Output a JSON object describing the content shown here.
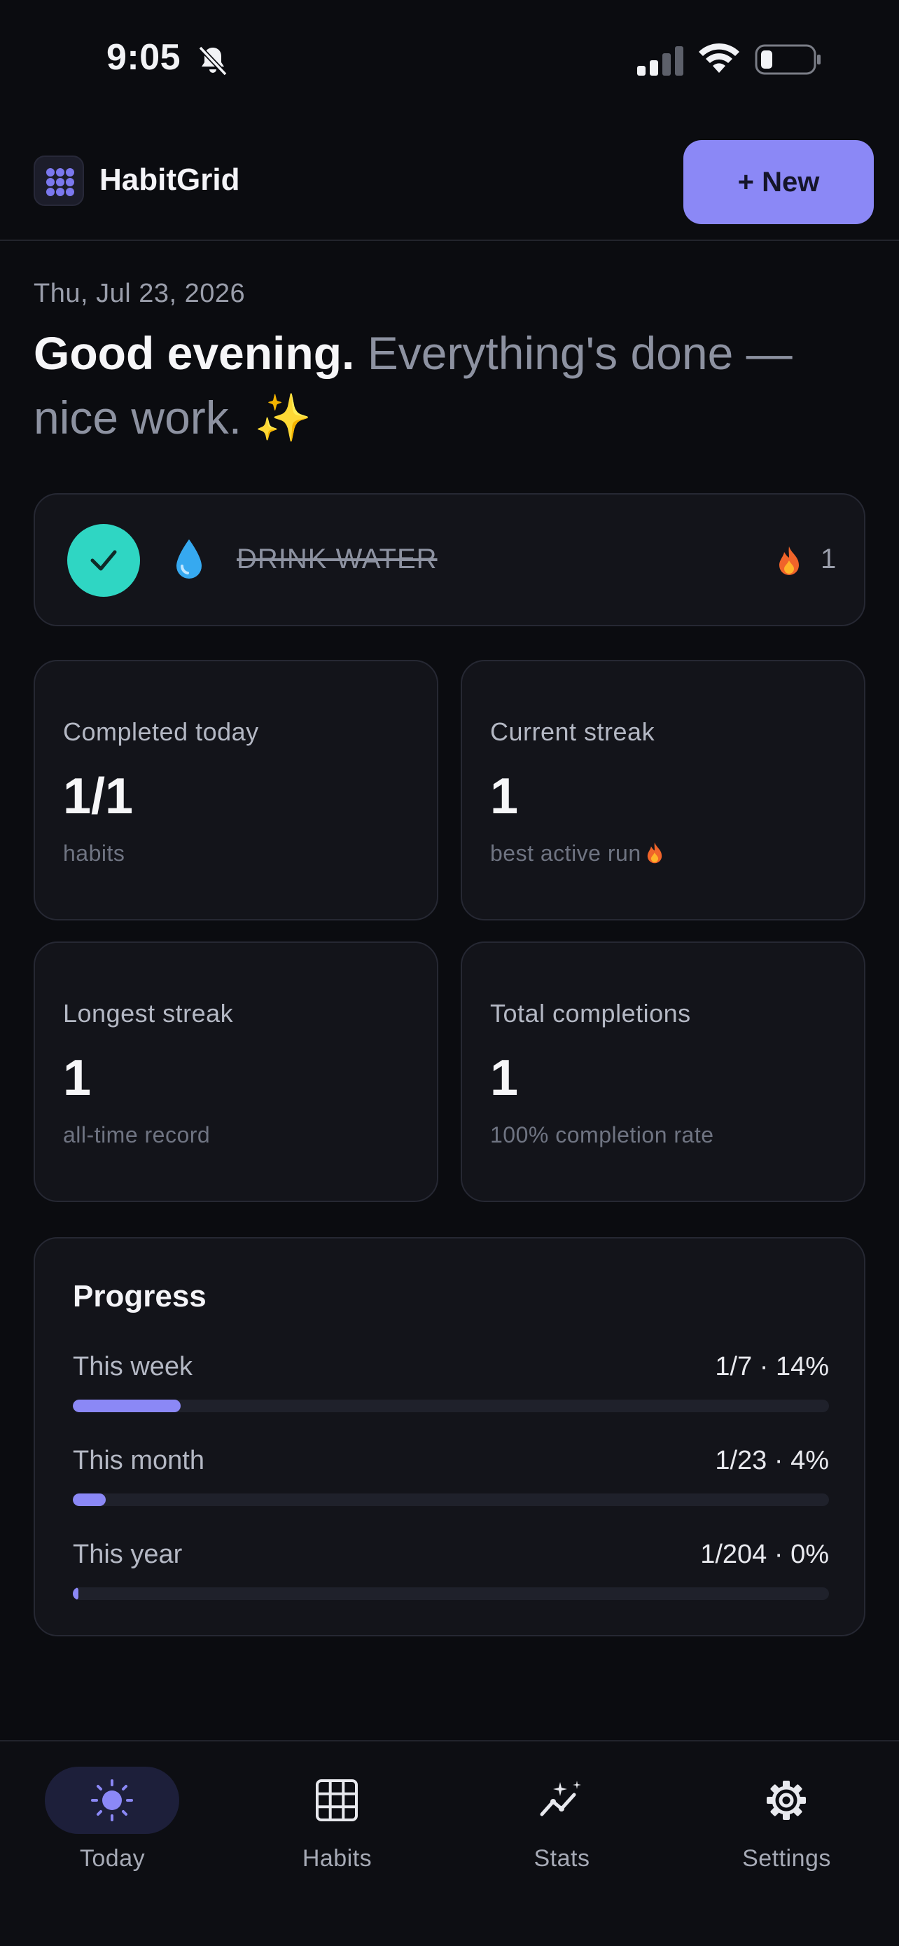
{
  "status_bar": {
    "time": "9:05"
  },
  "header": {
    "app_title": "HabitGrid",
    "new_button_label": "+ New"
  },
  "greeting": {
    "date": "Thu, Jul 23, 2026",
    "strong": "Good evening.",
    "message": " Everything's done — nice work. ✨"
  },
  "habits": [
    {
      "name": "DRINK WATER",
      "icon": "water-drop-icon",
      "completed": true,
      "streak": "1"
    }
  ],
  "stats": {
    "completed_today": {
      "label": "Completed today",
      "value": "1/1",
      "sub": "habits"
    },
    "current_streak": {
      "label": "Current streak",
      "value": "1",
      "sub": "best active run"
    },
    "longest_streak": {
      "label": "Longest streak",
      "value": "1",
      "sub": "all-time record"
    },
    "total_completions": {
      "label": "Total completions",
      "value": "1",
      "sub": "100% completion rate"
    }
  },
  "progress": {
    "title": "Progress",
    "rows": [
      {
        "label": "This week",
        "value": "1/7 · 14%",
        "fraction": 0.1428
      },
      {
        "label": "This month",
        "value": "1/23 · 4%",
        "fraction": 0.0435
      },
      {
        "label": "This year",
        "value": "1/204 · 0%",
        "fraction": 0.0049
      }
    ]
  },
  "tabs": [
    {
      "label": "Today",
      "icon": "sun-icon",
      "active": true
    },
    {
      "label": "Habits",
      "icon": "grid-icon",
      "active": false
    },
    {
      "label": "Stats",
      "icon": "sparkle-chart-icon",
      "active": false
    },
    {
      "label": "Settings",
      "icon": "gear-icon",
      "active": false
    }
  ],
  "colors": {
    "background": "#0b0c10",
    "card": "#13141a",
    "accent": "#8b88f6",
    "check": "#2fd6c3",
    "muted_text": "#8d92a1"
  }
}
